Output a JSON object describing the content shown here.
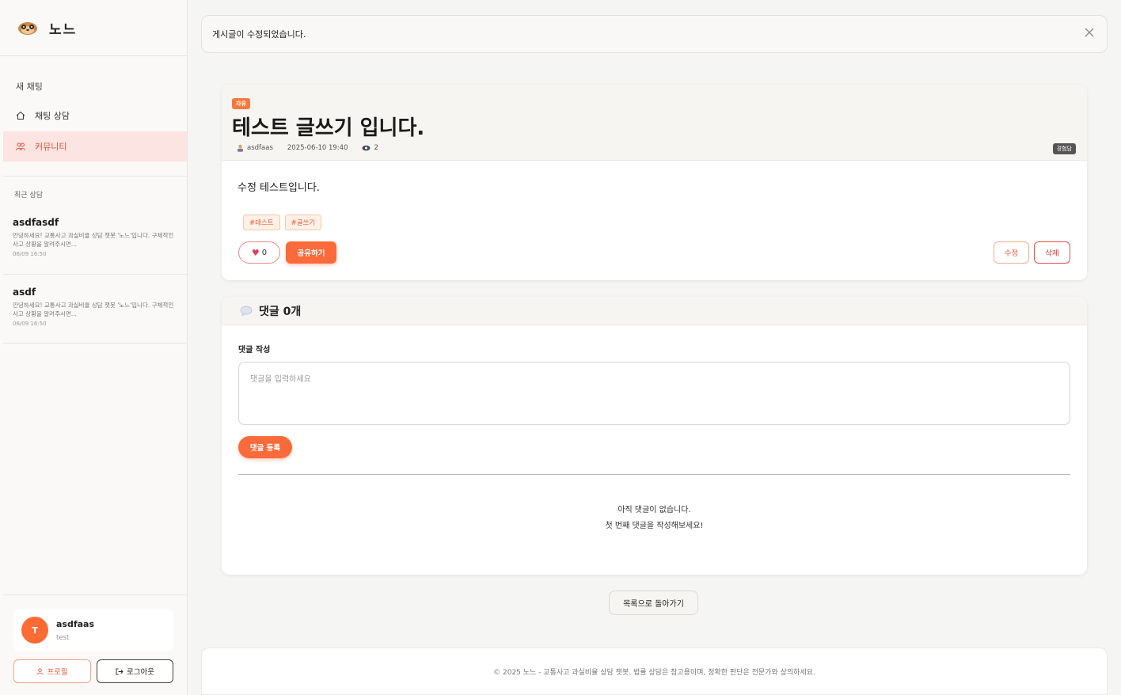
{
  "sidebar": {
    "brand": "노느",
    "new_chat": "새 채팅",
    "nav": [
      {
        "label": "채팅 상담",
        "icon": "home-icon"
      },
      {
        "label": "커뮤니티",
        "icon": "users-icon"
      }
    ],
    "recent_heading": "최근 상담",
    "recent": [
      {
        "title": "asdfasdf",
        "preview": "안녕하세요! 교통사고 과실비율 상담 챗봇 '노느'입니다. 구체적인 사고 상황을 알려주시면...",
        "date": "06/09 16:50"
      },
      {
        "title": "asdf",
        "preview": "안녕하세요! 교통사고 과실비율 상담 챗봇 '노느'입니다. 구체적인 사고 상황을 알려주시면...",
        "date": "06/09 16:50"
      }
    ],
    "user": {
      "initial": "T",
      "name": "asdfaas",
      "sub": "test"
    },
    "profile_label": "프로필",
    "logout_label": "로그아웃"
  },
  "alert": {
    "message": "게시글이 수정되었습니다."
  },
  "post": {
    "category": "자유",
    "title": "테스트 글쓰기 입니다.",
    "author": "asdfaas",
    "datetime": "2025-06-10 19:40",
    "views": "2",
    "badge": "경험담",
    "content": "수정 테스트입니다.",
    "tags": [
      "#테스트",
      "#글쓰기"
    ],
    "likes": "0",
    "share_label": "공유하기",
    "edit_label": "수정",
    "delete_label": "삭제"
  },
  "comments": {
    "header": "댓글 0개",
    "write_label": "댓글 작성",
    "placeholder": "댓글을 입력하세요",
    "submit_label": "댓글 등록",
    "empty_line1": "아직 댓글이 없습니다.",
    "empty_line2": "첫 번째 댓글을 작성해보세요!"
  },
  "back_label": "목록으로 돌아가기",
  "footer": "© 2025 노느 - 교통사고 과실비율 상담 챗봇. 법률 상담은 참고용이며, 정확한 판단은 전문가와 상의하세요.",
  "colors": {
    "accent": "#fa6a3a",
    "active_nav_bg": "#fbe4e1",
    "danger": "#d8312c"
  }
}
